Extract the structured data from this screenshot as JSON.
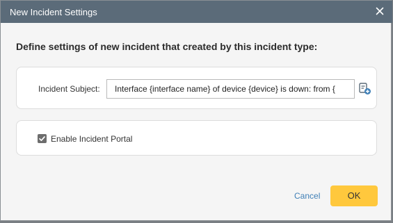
{
  "dialog": {
    "title": "New Incident Settings",
    "close_icon": "close-icon",
    "heading": "Define settings of new incident that created by this incident type:"
  },
  "subject": {
    "label": "Incident Subject:",
    "value": "Interface {interface name} of device {device} is down: from {",
    "insert_variable_icon": "add-variable-icon"
  },
  "portal": {
    "checkbox_checked": true,
    "label": "Enable Incident Portal"
  },
  "footer": {
    "cancel_label": "Cancel",
    "ok_label": "OK"
  },
  "colors": {
    "titlebar": "#5b6b79",
    "ok_button": "#ffc83d",
    "link": "#3f7fb6"
  }
}
